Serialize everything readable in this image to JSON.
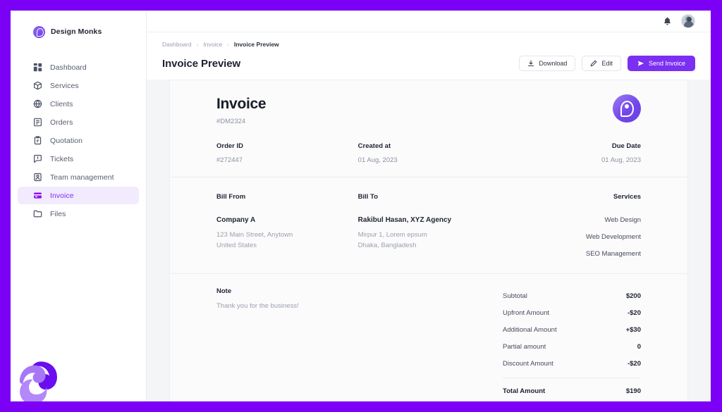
{
  "brand": {
    "name": "Design Monks",
    "logo_icon": "design-monks-logo-icon"
  },
  "sidebar": {
    "items": [
      {
        "label": "Dashboard",
        "icon": "grid-icon",
        "active": false
      },
      {
        "label": "Services",
        "icon": "box-icon",
        "active": false
      },
      {
        "label": "Clients",
        "icon": "globe-icon",
        "active": false
      },
      {
        "label": "Orders",
        "icon": "list-icon",
        "active": false
      },
      {
        "label": "Quotation",
        "icon": "clipboard-icon",
        "active": false
      },
      {
        "label": "Tickets",
        "icon": "message-icon",
        "active": false
      },
      {
        "label": "Team management",
        "icon": "id-card-icon",
        "active": false
      },
      {
        "label": "Invoice",
        "icon": "credit-card-icon",
        "active": true
      },
      {
        "label": "Files",
        "icon": "folder-icon",
        "active": false
      }
    ]
  },
  "topbar": {
    "notification_icon": "bell-icon",
    "avatar_icon": "user-avatar"
  },
  "header": {
    "breadcrumb": [
      {
        "label": "Dashboard"
      },
      {
        "label": "Invoice"
      },
      {
        "label": "Invoice Preview"
      }
    ],
    "breadcrumb_separator": "›",
    "title": "Invoice Preview",
    "buttons": {
      "download": {
        "label": "Download",
        "icon": "download-icon"
      },
      "edit": {
        "label": "Edit",
        "icon": "pencil-icon"
      },
      "send": {
        "label": "Send Invoice",
        "icon": "send-icon"
      }
    }
  },
  "invoice": {
    "title": "Invoice",
    "number": "#DM2324",
    "logo_icon": "invoice-brand-logo-icon",
    "meta": [
      {
        "label": "Order ID",
        "value": "#272447"
      },
      {
        "label": "Created at",
        "value": "01 Aug, 2023"
      },
      {
        "label": "Due Date",
        "value": "01 Aug, 2023"
      }
    ],
    "bill_from": {
      "label": "Bill From",
      "name": "Company A",
      "address_line1": "123 Main Street, Anytown",
      "address_line2": "United States"
    },
    "bill_to": {
      "label": "Bill To",
      "name": "Rakibul Hasan, XYZ Agency",
      "address_line1": "Mirpur 1, Lorem epsum",
      "address_line2": "Dhaka, Bangladesh"
    },
    "services": {
      "label": "Services",
      "items": [
        "Web Design",
        "Web Development",
        "SEO Management"
      ]
    },
    "note": {
      "label": "Note",
      "text": "Thank you for the business!"
    },
    "totals": {
      "rows": [
        {
          "label": "Subtotal",
          "value": "$200"
        },
        {
          "label": "Upfront Amount",
          "value": "-$20"
        },
        {
          "label": "Additional Amount",
          "value": "+$30"
        },
        {
          "label": "Partial amount",
          "value": "0"
        },
        {
          "label": "Discount Amount",
          "value": "-$20"
        }
      ],
      "grand": {
        "label": "Total Amount",
        "value": "$190"
      }
    }
  },
  "theme": {
    "frame_purple": "#7b00f5",
    "accent_purple": "#7b2ff2",
    "active_nav_bg": "#f2eafd",
    "page_bg": "#f4f5f7",
    "card_bg": "#fbfbfc"
  }
}
